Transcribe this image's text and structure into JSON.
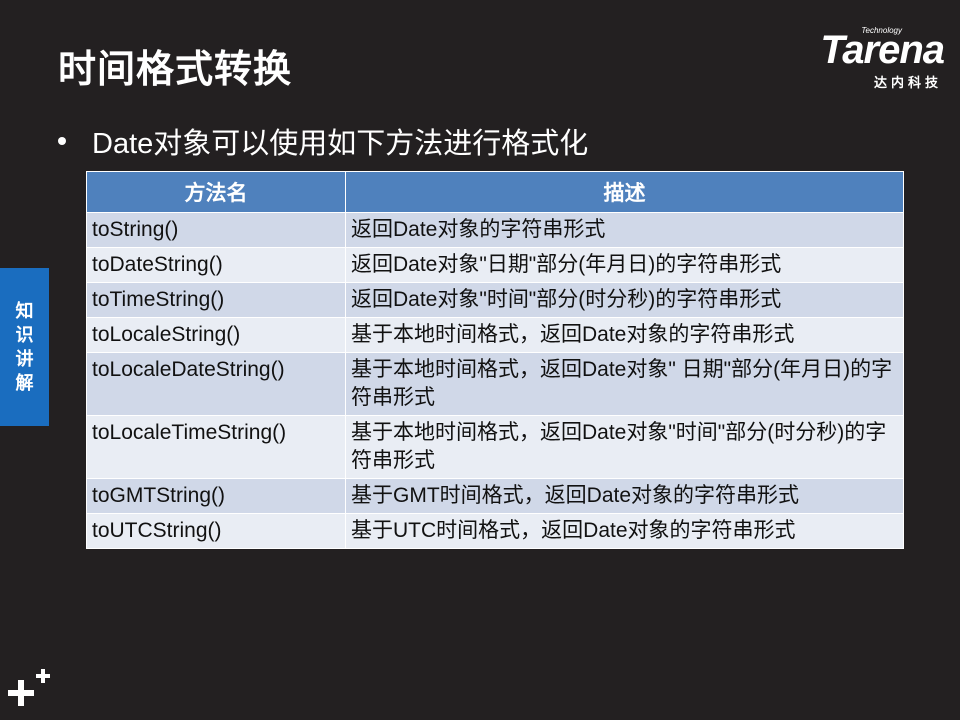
{
  "slide": {
    "title": "时间格式转换",
    "bullet": "Date对象可以使用如下方法进行格式化",
    "side_tab": [
      "知",
      "识",
      "讲",
      "解"
    ]
  },
  "logo": {
    "tagline": "Technology",
    "word": "Tarena",
    "chinese": "达内科技"
  },
  "table": {
    "headers": [
      "方法名",
      "描述"
    ],
    "rows": [
      {
        "method": "toString()",
        "desc": "返回Date对象的字符串形式"
      },
      {
        "method": "toDateString()",
        "desc": "返回Date对象\"日期\"部分(年月日)的字符串形式"
      },
      {
        "method": "toTimeString()",
        "desc": "返回Date对象\"时间\"部分(时分秒)的字符串形式"
      },
      {
        "method": "toLocaleString()",
        "desc": "基于本地时间格式，返回Date对象的字符串形式"
      },
      {
        "method": "toLocaleDateString()",
        "desc": "基于本地时间格式，返回Date对象\" 日期\"部分(年月日)的字符串形式"
      },
      {
        "method": "toLocaleTimeString()",
        "desc": "基于本地时间格式，返回Date对象\"时间\"部分(时分秒)的字符串形式"
      },
      {
        "method": "toGMTString()",
        "desc": "基于GMT时间格式，返回Date对象的字符串形式"
      },
      {
        "method": "toUTCString()",
        "desc": "基于UTC时间格式，返回Date对象的字符串形式"
      }
    ]
  },
  "colors": {
    "background": "#232021",
    "header": "#4f81bd",
    "row_odd": "#d0d8e8",
    "row_even": "#e9edf4",
    "side_tab": "#1a6dbf"
  },
  "icons": [
    "plus-icon",
    "bullet-icon"
  ]
}
